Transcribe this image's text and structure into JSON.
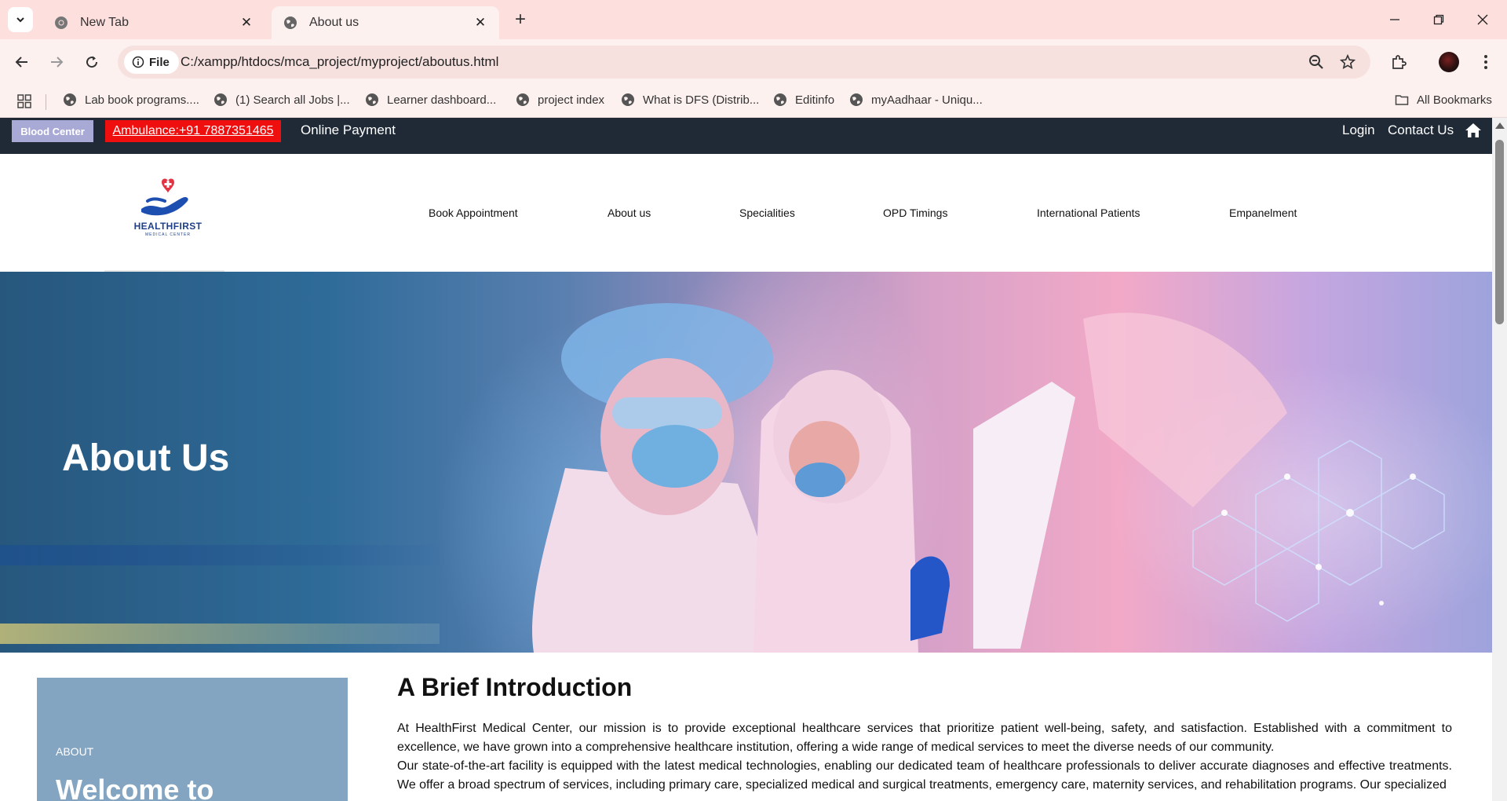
{
  "browser": {
    "tabs": [
      {
        "title": "New Tab",
        "active": false
      },
      {
        "title": "About us",
        "active": true
      }
    ],
    "url_chip": "File",
    "url": "C:/xampp/htdocs/mca_project/myproject/aboutus.html",
    "bookmarks": [
      "Lab book programs....",
      "(1) Search all Jobs |...",
      "Learner dashboard...",
      "project index",
      "What is DFS (Distrib...",
      "Editinfo",
      "myAadhaar - Uniqu..."
    ],
    "all_bookmarks": "All Bookmarks"
  },
  "topbar": {
    "blood_center": "Blood Center",
    "ambulance": "Ambulance:+91 7887351465",
    "online_payment": "Online Payment",
    "login": "Login",
    "contact": "Contact Us"
  },
  "logo": {
    "name": "HEALTHFIRST",
    "sub": "MEDICAL CENTER"
  },
  "nav": [
    "Book Appointment",
    "About us",
    "Specialities",
    "OPD Timings",
    "International Patients",
    "Empanelment"
  ],
  "hero": {
    "title": "About Us"
  },
  "sidebox": {
    "label": "ABOUT",
    "heading": "Welcome to"
  },
  "intro": {
    "title": "A Brief Introduction",
    "paragraphs": [
      "At HealthFirst Medical Center, our mission is to provide exceptional healthcare services that prioritize patient well-being, safety, and satisfaction. Established with a commitment to excellence, we have grown into a comprehensive healthcare institution, offering a wide range of medical services to meet the diverse needs of our community.",
      "Our state-of-the-art facility is equipped with the latest medical technologies, enabling our dedicated team of healthcare professionals to deliver accurate diagnoses and effective treatments. We offer a broad spectrum of services, including primary care, specialized medical and surgical treatments, emergency care, maternity services, and rehabilitation programs. Our specialized"
    ]
  },
  "colors": {
    "topbar_bg": "#1f2a36",
    "ambulance_red": "#ef0f0f",
    "blood_center_bg": "#a9a9d6",
    "sidebox_bg": "#84a5c2",
    "logo_blue": "#1e3f8a"
  }
}
